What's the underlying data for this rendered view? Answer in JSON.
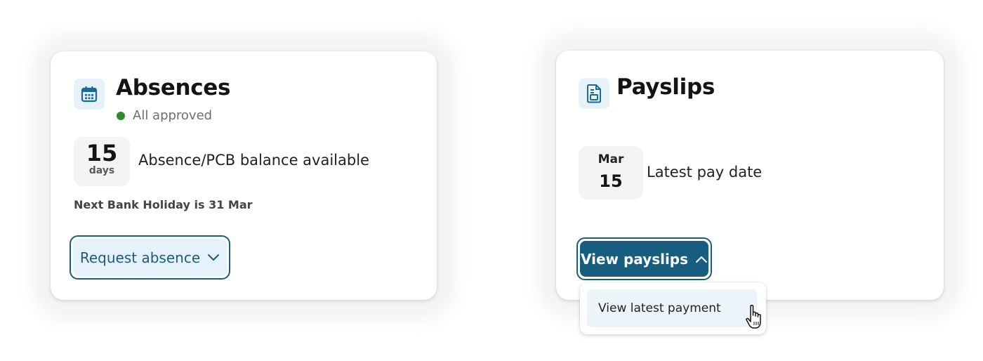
{
  "colors": {
    "accent": "#1b5d7b",
    "accent_fill": "#175d80",
    "accent_light": "#e6f2fb",
    "status_approved": "#2e8a2b"
  },
  "absences": {
    "icon": "calendar-icon",
    "title": "Absences",
    "status": "All approved",
    "balance": {
      "value": "15",
      "unit": "days",
      "label": "Absence/PCB balance available"
    },
    "holiday_text": "Next Bank Holiday is 31 Mar",
    "request_button": {
      "label": "Request absence",
      "icon": "chevron-down-icon"
    }
  },
  "payslips": {
    "icon": "document-icon",
    "title": "Payslips",
    "latest_pay": {
      "month": "Mar",
      "day": "15",
      "label": "Latest pay date"
    },
    "view_button": {
      "label": "View payslips",
      "icon": "chevron-up-icon",
      "expanded": true
    },
    "dropdown": {
      "items": [
        {
          "label": "View latest payment"
        }
      ]
    }
  },
  "cursor": {
    "icon": "hand-pointer-icon"
  }
}
